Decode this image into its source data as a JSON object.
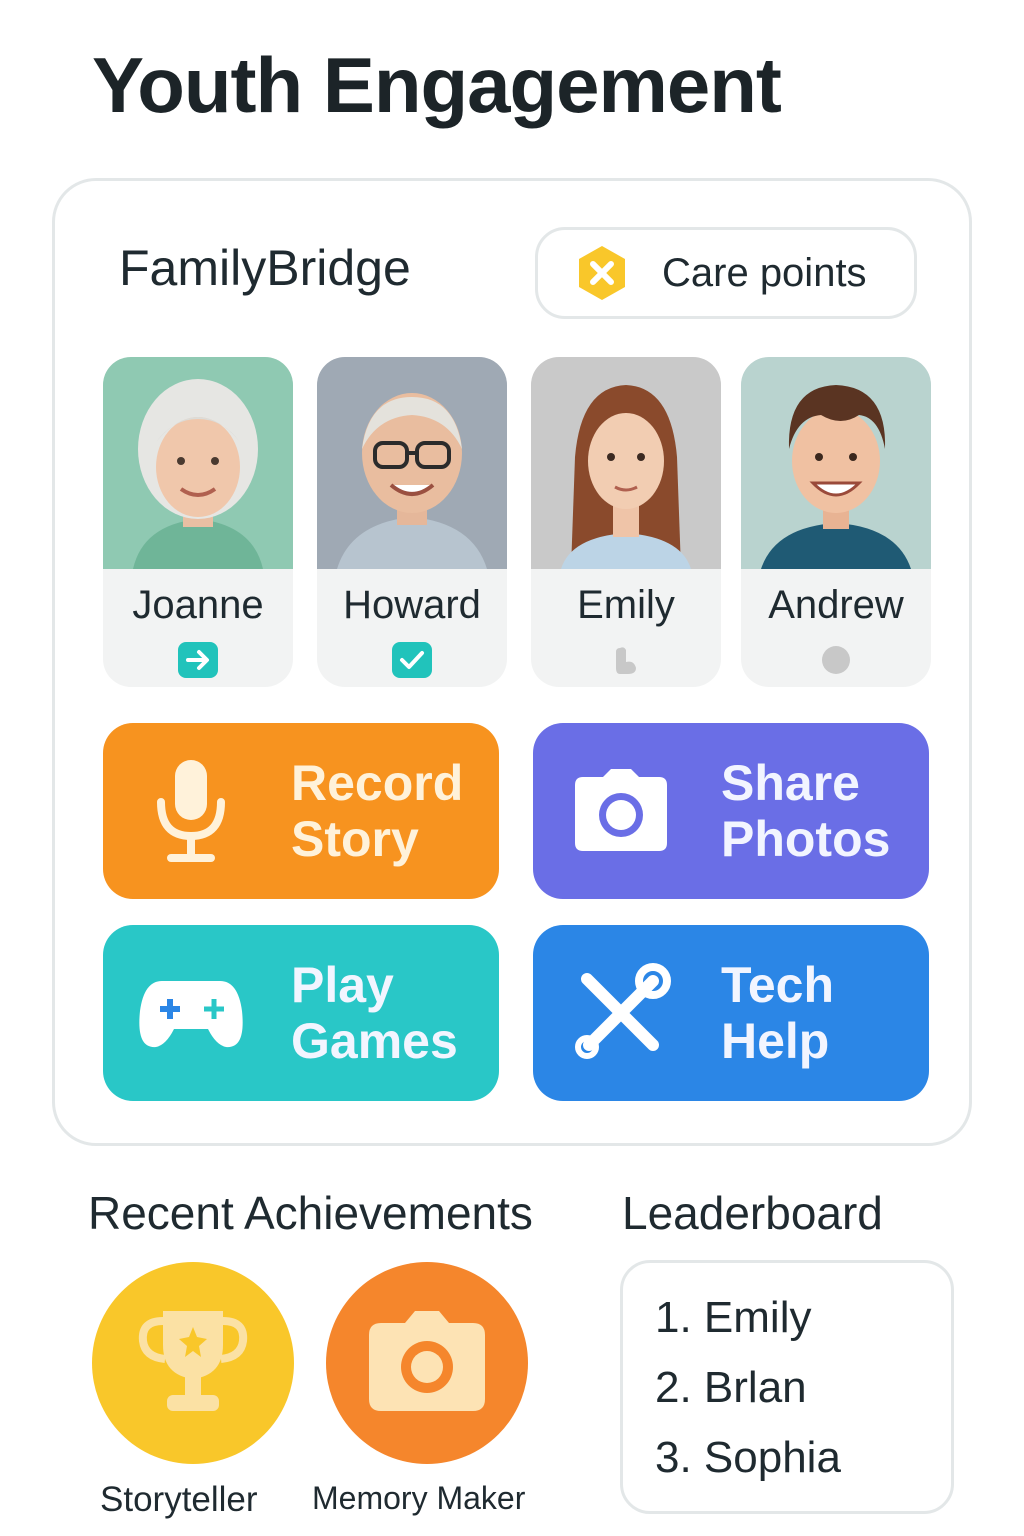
{
  "page": {
    "title": "Youth Engagement"
  },
  "app": {
    "name": "FamilyBridge",
    "care_points_label": "Care points"
  },
  "colors": {
    "orange": "#f7931f",
    "purple": "#6a6ee6",
    "teal": "#29c7c7",
    "blue": "#2b86e6",
    "gold": "#f9c72a",
    "status_teal": "#21c3bb"
  },
  "members": [
    {
      "name": "Joanne",
      "status_icon": "arrow-right-icon"
    },
    {
      "name": "Howard",
      "status_icon": "check-icon"
    },
    {
      "name": "Emily",
      "status_icon": "hand-icon"
    },
    {
      "name": "Andrew",
      "status_icon": "dot-icon"
    }
  ],
  "actions": [
    {
      "label": "Record\nStory",
      "icon": "microphone-icon"
    },
    {
      "label": "Share\nPhotos",
      "icon": "camera-icon"
    },
    {
      "label": "Play\nGames",
      "icon": "gamepad-icon"
    },
    {
      "label": "Tech\nHelp",
      "icon": "tools-icon"
    }
  ],
  "achievements": {
    "title": "Recent Achievements",
    "items": [
      {
        "label": "Storyteller",
        "icon": "trophy-icon"
      },
      {
        "label": "Memory Maker",
        "icon": "camera-icon"
      }
    ]
  },
  "leaderboard": {
    "title": "Leaderboard",
    "entries": [
      "1. Emily",
      "2. Brlan",
      "3. Sophia"
    ]
  }
}
